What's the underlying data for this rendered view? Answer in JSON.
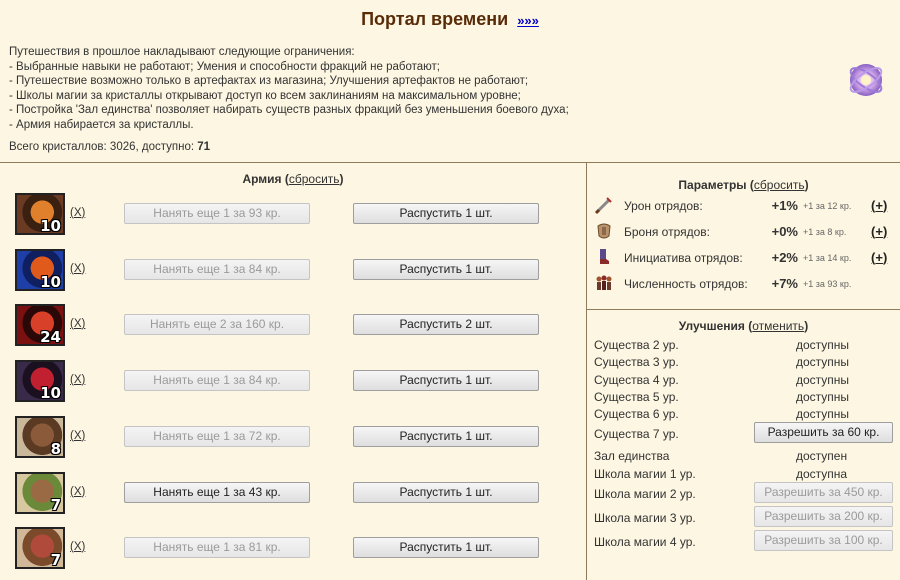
{
  "header": {
    "title": "Портал времени",
    "more_link": "»»»"
  },
  "intro": {
    "lines": [
      "Путешествия в прошлое накладывают следующие ограничения:",
      "- Выбранные навыки не работают; Умения и способности фракций не работают;",
      "- Путешествие возможно только в артефактах из магазина; Улучшения артефактов не работают;",
      "- Школы магии за кристаллы открывают доступ ко всем заклинаниям на максимальном уровне;",
      "- Постройка 'Зал единства' позволяет набирать существ разных фракций без уменьшения боевого духа;",
      "- Армия набирается за кристаллы."
    ],
    "crystals_prefix": "Всего кристаллов: 3026, доступно:",
    "crystals_available": "71"
  },
  "army": {
    "title": "Армия",
    "reset_link": "сбросить",
    "remove_label": "X",
    "units": [
      {
        "level": "10",
        "hire_label": "Нанять еще 1 за 93 кр.",
        "hire_enabled": false,
        "dismiss_label": "Распустить 1 шт."
      },
      {
        "level": "10",
        "hire_label": "Нанять еще 1 за 84 кр.",
        "hire_enabled": false,
        "dismiss_label": "Распустить 1 шт."
      },
      {
        "level": "24",
        "hire_label": "Нанять еще 2 за 160 кр.",
        "hire_enabled": false,
        "dismiss_label": "Распустить 2 шт."
      },
      {
        "level": "10",
        "hire_label": "Нанять еще 1 за 84 кр.",
        "hire_enabled": false,
        "dismiss_label": "Распустить 1 шт."
      },
      {
        "level": "8",
        "hire_label": "Нанять еще 1 за 72 кр.",
        "hire_enabled": false,
        "dismiss_label": "Распустить 1 шт."
      },
      {
        "level": "7",
        "hire_label": "Нанять еще 1 за 43 кр.",
        "hire_enabled": true,
        "dismiss_label": "Распустить 1 шт."
      },
      {
        "level": "7",
        "hire_label": "Нанять еще 1 за 81 кр.",
        "hire_enabled": false,
        "dismiss_label": "Распустить 1 шт."
      }
    ]
  },
  "params": {
    "title": "Параметры",
    "reset_link": "сбросить",
    "items": [
      {
        "label": "Урон отрядов:",
        "value": "+1%",
        "cost": "+1 за 12 кр.",
        "plus": "+",
        "icon": "sword-icon"
      },
      {
        "label": "Броня отрядов:",
        "value": "+0%",
        "cost": "+1 за 8 кр.",
        "plus": "+",
        "icon": "armor-icon"
      },
      {
        "label": "Инициатива отрядов:",
        "value": "+2%",
        "cost": "+1 за 14 кр.",
        "plus": "+",
        "icon": "boots-icon"
      },
      {
        "label": "Численность отрядов:",
        "value": "+7%",
        "cost": "+1 за 93 кр.",
        "plus": "",
        "icon": "troops-icon"
      }
    ]
  },
  "upgrades": {
    "title": "Улучшения",
    "cancel_link": "отменить",
    "items": [
      {
        "label": "Существа 2 ур.",
        "status": "доступны"
      },
      {
        "label": "Существа 3 ур.",
        "status": "доступны"
      },
      {
        "label": "Существа 4 ур.",
        "status": "доступны"
      },
      {
        "label": "Существа 5 ур.",
        "status": "доступны"
      },
      {
        "label": "Существа 6 ур.",
        "status": "доступны"
      },
      {
        "label": "Существа 7 ур.",
        "button": "Разрешить за 60 кр.",
        "button_enabled": true
      },
      {
        "label": "Зал единства",
        "status": "доступен"
      },
      {
        "label": "Школа магии 1 ур.",
        "status": "доступна"
      },
      {
        "label": "Школа магии 2 ур.",
        "button": "Разрешить за 450 кр.",
        "button_enabled": false
      },
      {
        "label": "Школа магии 3 ур.",
        "button": "Разрешить за 200 кр.",
        "button_enabled": false
      },
      {
        "label": "Школа магии 4 ур.",
        "button": "Разрешить за 100 кр.",
        "button_enabled": false
      }
    ]
  },
  "colors": {
    "background": "#fcf6e2",
    "title": "#592c08",
    "link": "#0000cc",
    "divider": "#8c7b5c"
  }
}
